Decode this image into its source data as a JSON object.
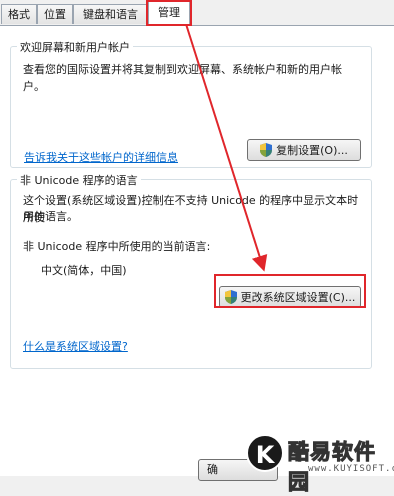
{
  "tabs": [
    {
      "label": "格式"
    },
    {
      "label": "位置"
    },
    {
      "label": "键盘和语言"
    },
    {
      "label": "管理"
    }
  ],
  "welcome": {
    "title": "欢迎屏幕和新用户帐户",
    "description": "查看您的国际设置并将其复制到欢迎屏幕、系统帐户和新的用户帐户。",
    "copy_button": "复制设置(O)...",
    "link": "告诉我关于这些帐户的详细信息"
  },
  "unicode": {
    "title": "非 Unicode 程序的语言",
    "description_line1": "这个设置(系统区域设置)控制在不支持 Unicode 的程序中显示文本时所使",
    "description_line2": "用的语言。",
    "current_label": "非 Unicode 程序中所使用的当前语言:",
    "current_value": "中文(简体，中国)",
    "change_button": "更改系统区域设置(C)...",
    "link": "什么是系统区域设置?"
  },
  "footer": {
    "partial_button": "确"
  },
  "watermark": {
    "badge": "K",
    "name": "酷易软件园",
    "url": "www.KUYISOFT.com"
  },
  "colors": {
    "highlight": "#e0262b",
    "link": "#0066cc"
  }
}
